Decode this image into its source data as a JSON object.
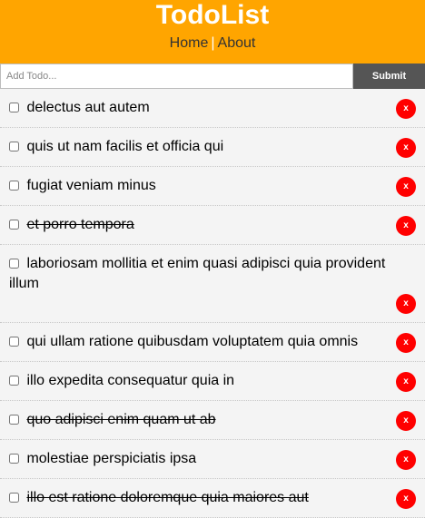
{
  "header": {
    "title": "TodoList",
    "nav": [
      {
        "label": "Home"
      },
      {
        "label": "About"
      }
    ],
    "separator": "|"
  },
  "form": {
    "placeholder": "Add Todo...",
    "submit_label": "Submit"
  },
  "todos": [
    {
      "title": "delectus aut autem",
      "completed": false,
      "delete_label": "x"
    },
    {
      "title": "quis ut nam facilis et officia qui",
      "completed": false,
      "delete_label": "x"
    },
    {
      "title": "fugiat veniam minus",
      "completed": false,
      "delete_label": "x"
    },
    {
      "title": "et porro tempora",
      "completed": true,
      "delete_label": "x"
    },
    {
      "title": "laboriosam mollitia et enim quasi adipisci quia provident illum",
      "completed": false,
      "delete_label": "x"
    },
    {
      "title": "qui ullam ratione quibusdam voluptatem quia omnis",
      "completed": false,
      "delete_label": "x"
    },
    {
      "title": "illo expedita consequatur quia in",
      "completed": false,
      "delete_label": "x"
    },
    {
      "title": "quo adipisci enim quam ut ab",
      "completed": true,
      "delete_label": "x"
    },
    {
      "title": "molestiae perspiciatis ipsa",
      "completed": false,
      "delete_label": "x"
    },
    {
      "title": "illo est ratione doloremque quia maiores aut",
      "completed": true,
      "delete_label": "x"
    }
  ],
  "colors": {
    "header_bg": "#ffa500",
    "submit_bg": "#555555",
    "delete_bg": "#ff0000",
    "item_bg": "#f4f4f4"
  }
}
